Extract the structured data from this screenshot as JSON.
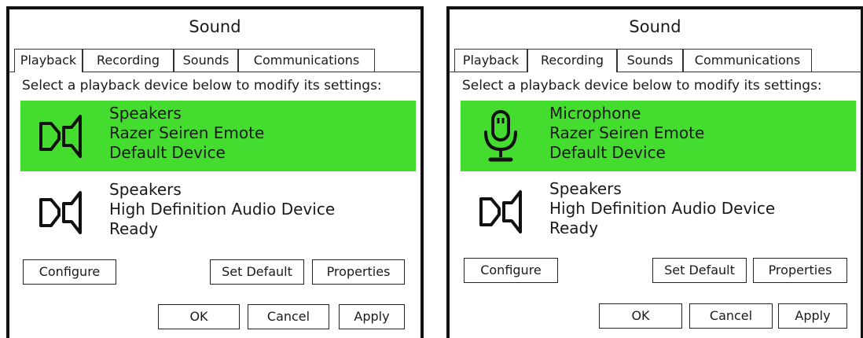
{
  "dialogs": [
    {
      "title": "Sound",
      "tabs": [
        {
          "label": "Playback",
          "selected": true
        },
        {
          "label": "Recording",
          "selected": false
        },
        {
          "label": "Sounds",
          "selected": false
        },
        {
          "label": "Communications",
          "selected": false
        }
      ],
      "instruction": "Select a playback device below to modify its settings:",
      "devices": [
        {
          "icon": "speaker-icon",
          "name": "Speakers",
          "model": "Razer Seiren Emote",
          "status": "Default Device",
          "selected": true
        },
        {
          "icon": "speaker-icon",
          "name": "Speakers",
          "model": "High Definition Audio Device",
          "status": "Ready",
          "selected": false
        }
      ],
      "buttons": {
        "configure": "Configure",
        "set_default": "Set Default",
        "properties": "Properties",
        "ok": "OK",
        "cancel": "Cancel",
        "apply": "Apply"
      }
    },
    {
      "title": "Sound",
      "tabs": [
        {
          "label": "Playback",
          "selected": false
        },
        {
          "label": "Recording",
          "selected": true
        },
        {
          "label": "Sounds",
          "selected": false
        },
        {
          "label": "Communications",
          "selected": false
        }
      ],
      "instruction": "Select a playback device below to modify its settings:",
      "devices": [
        {
          "icon": "microphone-icon",
          "name": "Microphone",
          "model": "Razer Seiren Emote",
          "status": "Default Device",
          "selected": true
        },
        {
          "icon": "speaker-icon",
          "name": "Speakers",
          "model": "High Definition Audio Device",
          "status": "Ready",
          "selected": false
        }
      ],
      "buttons": {
        "configure": "Configure",
        "set_default": "Set Default",
        "properties": "Properties",
        "ok": "OK",
        "cancel": "Cancel",
        "apply": "Apply"
      }
    }
  ],
  "colors": {
    "selected_row": "#44dd2f",
    "border": "#111111"
  }
}
